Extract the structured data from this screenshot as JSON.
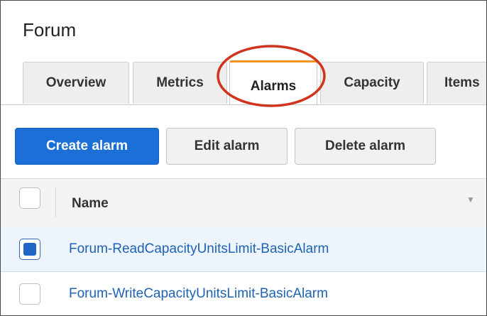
{
  "header": {
    "title": "Forum"
  },
  "tabs": [
    {
      "label": "Overview",
      "active": false
    },
    {
      "label": "Metrics",
      "active": false
    },
    {
      "label": "Alarms",
      "active": true
    },
    {
      "label": "Capacity",
      "active": false
    },
    {
      "label": "Items",
      "active": false
    }
  ],
  "toolbar": {
    "create_label": "Create alarm",
    "edit_label": "Edit alarm",
    "delete_label": "Delete alarm"
  },
  "table": {
    "columns": [
      "Name"
    ],
    "rows": [
      {
        "name": "Forum-ReadCapacityUnitsLimit-BasicAlarm",
        "checked": true
      },
      {
        "name": "Forum-WriteCapacityUnitsLimit-BasicAlarm",
        "checked": false
      }
    ]
  },
  "colors": {
    "active_tab_accent": "#f2931c",
    "primary_button": "#1c6fd6",
    "link": "#1d62b3",
    "annotation_circle": "#d0341c",
    "selected_row": "#edf4fc"
  },
  "icons": {
    "sort": "sort-caret-icon",
    "checkbox": "checkbox-icon"
  }
}
